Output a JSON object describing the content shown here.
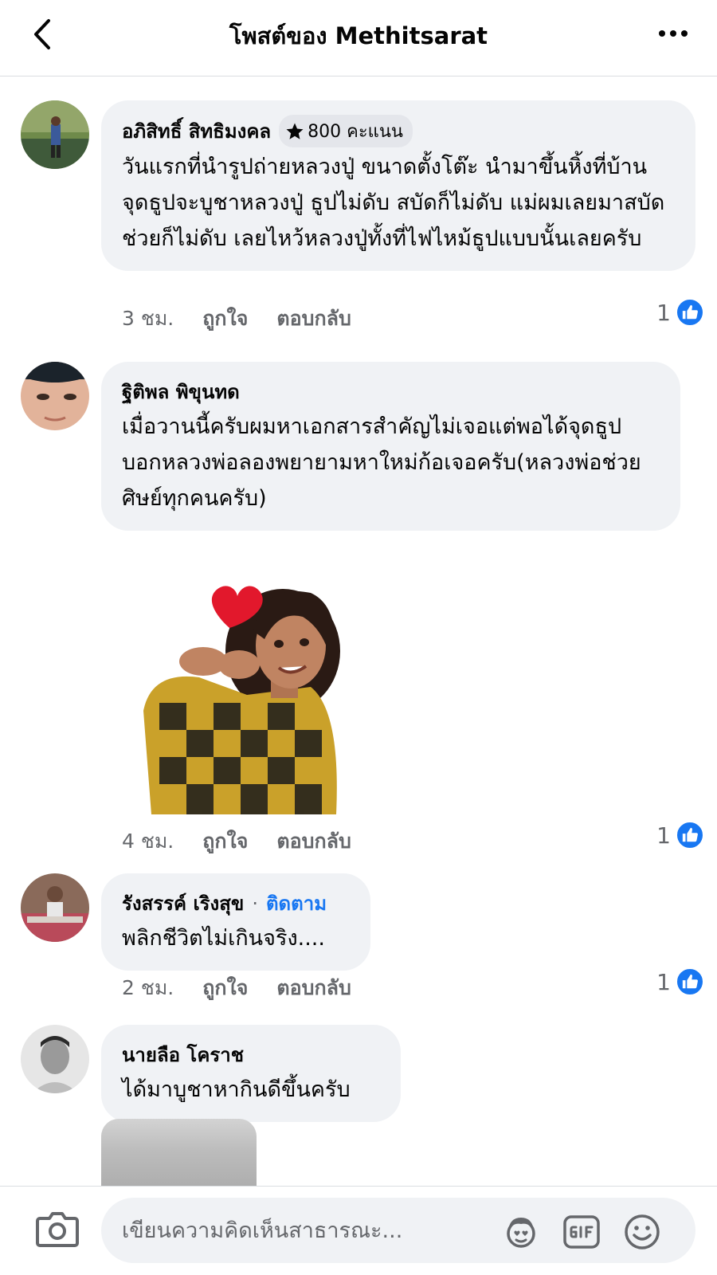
{
  "header": {
    "title": "โพสต์ของ Methitsarat"
  },
  "comments": [
    {
      "author": "อภิสิทธิ์ สิทธิมงคล",
      "badge": "800 คะแนน",
      "text": "วันแรกที่นำรูปถ่ายหลวงปู่ ขนาดตั้งโต๊ะ นำมาขึ้นหิ้งที่บ้าน จุดธูปจะบูชาหลวงปู่ ธูปไม่ดับ สบัดก็ไม่ดับ แม่ผมเลยมาสบัดช่วยก็ไม่ดับ เลยไหว้หลวงปู่ทั้งที่ไฟไหม้ธูปแบบนั้นเลยครับ",
      "time": "3 ชม.",
      "like_label": "ถูกใจ",
      "reply_label": "ตอบกลับ",
      "reaction_count": "1"
    },
    {
      "author": "ฐิติพล พิขุนทด",
      "text": "เมื่อวานนี้ครับผมหาเอกสารสำคัญไม่เจอแต่พอได้จุดธูปบอกหลวงพ่อลองพยายามหาใหม่ก้อเจอครับ(หลวงพ่อช่วยศิษย์ทุกคนครับ)",
      "time": "4 ชม.",
      "like_label": "ถูกใจ",
      "reply_label": "ตอบกลับ",
      "reaction_count": "1"
    },
    {
      "author": "รังสรรค์ เริงสุข",
      "follow_label": "ติดตาม",
      "text": "พลิกชีวิตไม่เกินจริง....",
      "time": "2 ชม.",
      "like_label": "ถูกใจ",
      "reply_label": "ตอบกลับ",
      "reaction_count": "1"
    },
    {
      "author": "นายลือ โคราช",
      "text": "ได้มาบูชาหากินดีขึ้นครับ"
    }
  ],
  "composer": {
    "placeholder": "เขียนความคิดเห็นสาธารณะ..."
  },
  "icons": {
    "back": "chevron-left-icon",
    "more": "more-horizontal-icon",
    "star": "star-icon",
    "like": "thumbs-up-icon",
    "camera": "camera-icon",
    "avatar_sticker": "avatar-sticker-icon",
    "gif": "gif-icon",
    "emoji": "emoji-icon"
  },
  "colors": {
    "accent": "#1877f2",
    "bubble": "#f0f2f5",
    "secondary_text": "#65676b"
  }
}
